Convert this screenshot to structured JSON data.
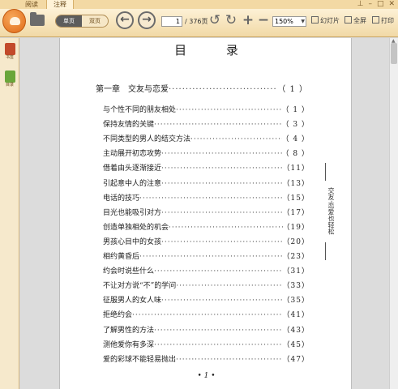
{
  "tabs": [
    "阅读",
    "注释"
  ],
  "toolbar": {
    "view_single": "单页",
    "view_double": "双页",
    "current_page": "1",
    "total_pages": "/ 376页",
    "zoom": "150%",
    "slideshow_label": "幻灯片",
    "fullscreen_label": "全屏",
    "print_label": "打印"
  },
  "sidebar": {
    "items": [
      {
        "label": "书签",
        "color": "#c24a2a"
      },
      {
        "label": "目录",
        "color": "#6aa63a"
      }
    ]
  },
  "document": {
    "title": "目  录",
    "chapter": {
      "title": "第一章　交友与恋爱",
      "page": "（ 1 ）"
    },
    "entries": [
      {
        "title": "与个性不同的朋友相处",
        "page": "（ 1 ）"
      },
      {
        "title": "保持友情的关键",
        "page": "（ 3 ）"
      },
      {
        "title": "不同类型的男人的结交方法",
        "page": "（ 4 ）"
      },
      {
        "title": "主动展开初恋攻势",
        "page": "（ 8 ）"
      },
      {
        "title": "借着由头逐渐接近",
        "page": "（11）"
      },
      {
        "title": "引起意中人的注意",
        "page": "（13）"
      },
      {
        "title": "电话的技巧",
        "page": "（15）"
      },
      {
        "title": "目光也能吸引对方",
        "page": "（17）"
      },
      {
        "title": "创造单独相处的机会",
        "page": "（19）"
      },
      {
        "title": "男孩心目中的女孩",
        "page": "（20）"
      },
      {
        "title": "相约黄昏后",
        "page": "（23）"
      },
      {
        "title": "约会时说些什么",
        "page": "（31）"
      },
      {
        "title": "不让对方说“不”的学问",
        "page": "（33）"
      },
      {
        "title": "征服男人的女人味",
        "page": "（35）"
      },
      {
        "title": "拒绝约会",
        "page": "（41）"
      },
      {
        "title": "了解男性的方法",
        "page": "（43）"
      },
      {
        "title": "测他爱你有多深",
        "page": "（45）"
      },
      {
        "title": "爱的彩球不能轻易抛出",
        "page": "（47）"
      }
    ],
    "running_title": "交友·恋爱也轻松",
    "page_number": "• 1 •"
  },
  "colors": {
    "toolbar": "#f1d9a6",
    "accent": "#e06a18"
  }
}
